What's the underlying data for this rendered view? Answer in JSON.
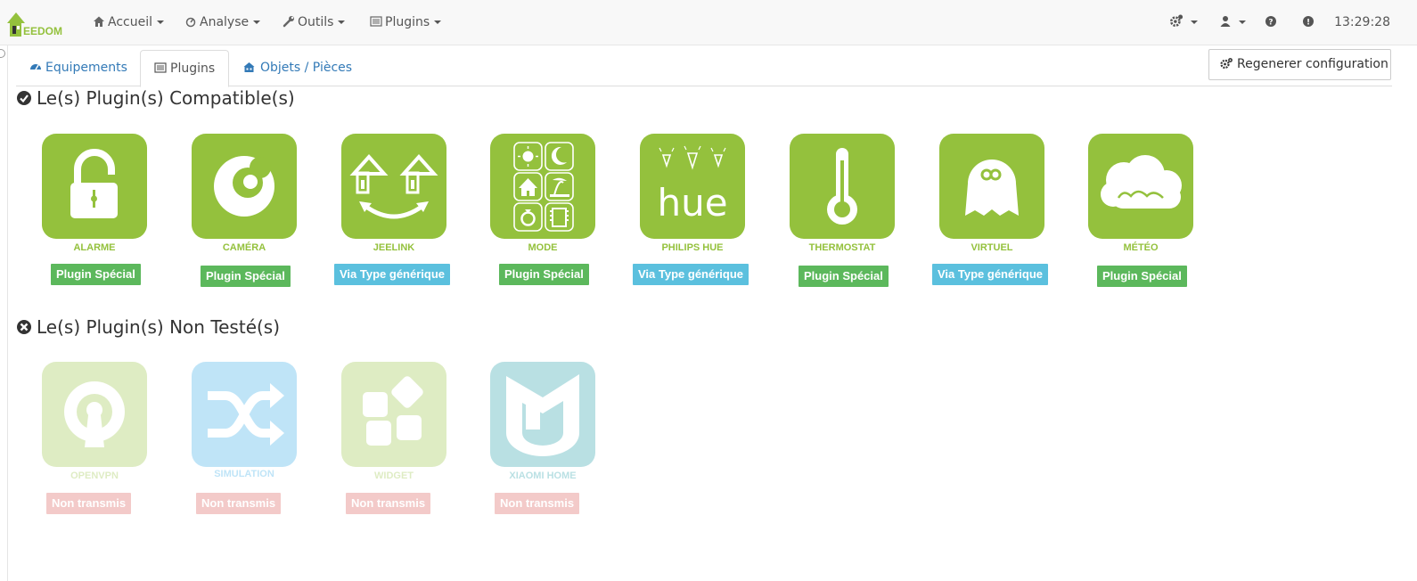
{
  "navbar": {
    "brand_text": "EEDOM",
    "menus": [
      {
        "label": "Accueil",
        "icon": "home-icon"
      },
      {
        "label": "Analyse",
        "icon": "analyse-icon"
      },
      {
        "label": "Outils",
        "icon": "wrench-icon"
      },
      {
        "label": "Plugins",
        "icon": "list-icon"
      }
    ],
    "right_icons": [
      "cogs-icon",
      "user-icon",
      "help-icon",
      "alert-icon"
    ],
    "clock": "13:29:28"
  },
  "tabs": [
    {
      "label": "Equipements",
      "icon": "dashboard-icon",
      "active": false
    },
    {
      "label": "Plugins",
      "icon": "list-alt-icon",
      "active": true
    },
    {
      "label": "Objets / Pièces",
      "icon": "building-icon",
      "active": false
    }
  ],
  "regen_button": {
    "label": "Regenerer configuration",
    "icon": "cogs-icon"
  },
  "sections": {
    "compatible": {
      "title": "Le(s) Plugin(s) Compatible(s)",
      "icon": "check-circle-icon"
    },
    "untested": {
      "title": "Le(s) Plugin(s) Non Testé(s)",
      "icon": "times-circle-icon"
    }
  },
  "compatible_plugins": [
    {
      "name": "ALARME",
      "badge": "Plugin Spécial",
      "badge_color": "#5cb85c",
      "icon": "padlock-icon"
    },
    {
      "name": "CAMÉRA",
      "badge": "Plugin Spécial",
      "badge_color": "#5cb85c",
      "icon": "camera-eye-icon"
    },
    {
      "name": "JEELINK",
      "badge": "Via Type générique",
      "badge_color": "#5bc0de",
      "icon": "houses-link-icon"
    },
    {
      "name": "MODE",
      "badge": "Plugin Spécial",
      "badge_color": "#5cb85c",
      "icon": "mode-grid-icon"
    },
    {
      "name": "PHILIPS HUE",
      "badge": "Via Type générique",
      "badge_color": "#5bc0de",
      "icon": "hue-icon"
    },
    {
      "name": "THERMOSTAT",
      "badge": "Plugin Spécial",
      "badge_color": "#5cb85c",
      "icon": "thermometer-icon"
    },
    {
      "name": "VIRTUEL",
      "badge": "Via Type générique",
      "badge_color": "#5bc0de",
      "icon": "ghost-icon"
    },
    {
      "name": "MÉTÉO",
      "badge": "Plugin Spécial",
      "badge_color": "#5cb85c",
      "icon": "weather-cloud-icon"
    }
  ],
  "untested_plugins": [
    {
      "name": "OPENVPN",
      "badge": "Non transmis",
      "badge_color": "#d9534f",
      "icon": "openvpn-icon"
    },
    {
      "name": "SIMULATION",
      "badge": "Non transmis",
      "badge_color": "#d9534f",
      "icon": "shuffle-icon"
    },
    {
      "name": "WIDGET",
      "badge": "Non transmis",
      "badge_color": "#d9534f",
      "icon": "widget-tiles-icon"
    },
    {
      "name": "XIAOMI HOME",
      "badge": "Non transmis",
      "badge_color": "#d9534f",
      "icon": "xiaomi-icon"
    }
  ],
  "colors": {
    "plugin_green": "#94c13d",
    "simulation_blue": "#2ea8e8",
    "xiaomi_teal": "#1a9aa6"
  }
}
